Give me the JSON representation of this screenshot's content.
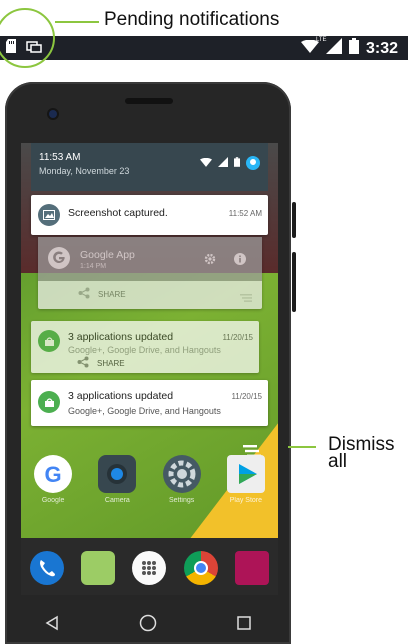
{
  "callouts": {
    "pending": "Pending notifications",
    "dismiss_line1": "Dismiss",
    "dismiss_line2": "all"
  },
  "status_bar": {
    "time": "3:32",
    "network": "LTE",
    "icons": [
      "sd-card-icon",
      "screenshot-icon",
      "wifi-icon",
      "signal-icon",
      "battery-icon"
    ]
  },
  "shade": {
    "time": "11:53 AM",
    "date": "Monday, November 23"
  },
  "notifications": [
    {
      "title": "Screenshot captured.",
      "time": "11:52 AM",
      "icon": "image-icon",
      "color": "#546e7a"
    },
    {
      "title": "Google App",
      "subtitle": "1:14 PM",
      "icon": "google-g-icon",
      "share": "SHARE"
    },
    {
      "title": "3 applications updated",
      "subtitle": "Google+, Google Drive, and Hangouts",
      "time": "11/20/15",
      "icon": "play-update-icon",
      "color": "#4caf50",
      "share": "SHARE"
    },
    {
      "title": "3 applications updated",
      "subtitle": "Google+, Google Drive, and Hangouts",
      "time": "11/20/15",
      "icon": "play-update-icon",
      "color": "#4caf50"
    }
  ],
  "apps": [
    {
      "label": "Google",
      "icon": "google-icon"
    },
    {
      "label": "Camera",
      "icon": "camera-icon"
    },
    {
      "label": "Settings",
      "icon": "settings-icon"
    },
    {
      "label": "Play Store",
      "icon": "play-store-icon"
    }
  ],
  "dock": [
    "phone-icon",
    "messaging-icon",
    "app-drawer-icon",
    "chrome-icon",
    "gallery-icon"
  ],
  "nav": [
    "back-icon",
    "home-icon",
    "recents-icon"
  ]
}
